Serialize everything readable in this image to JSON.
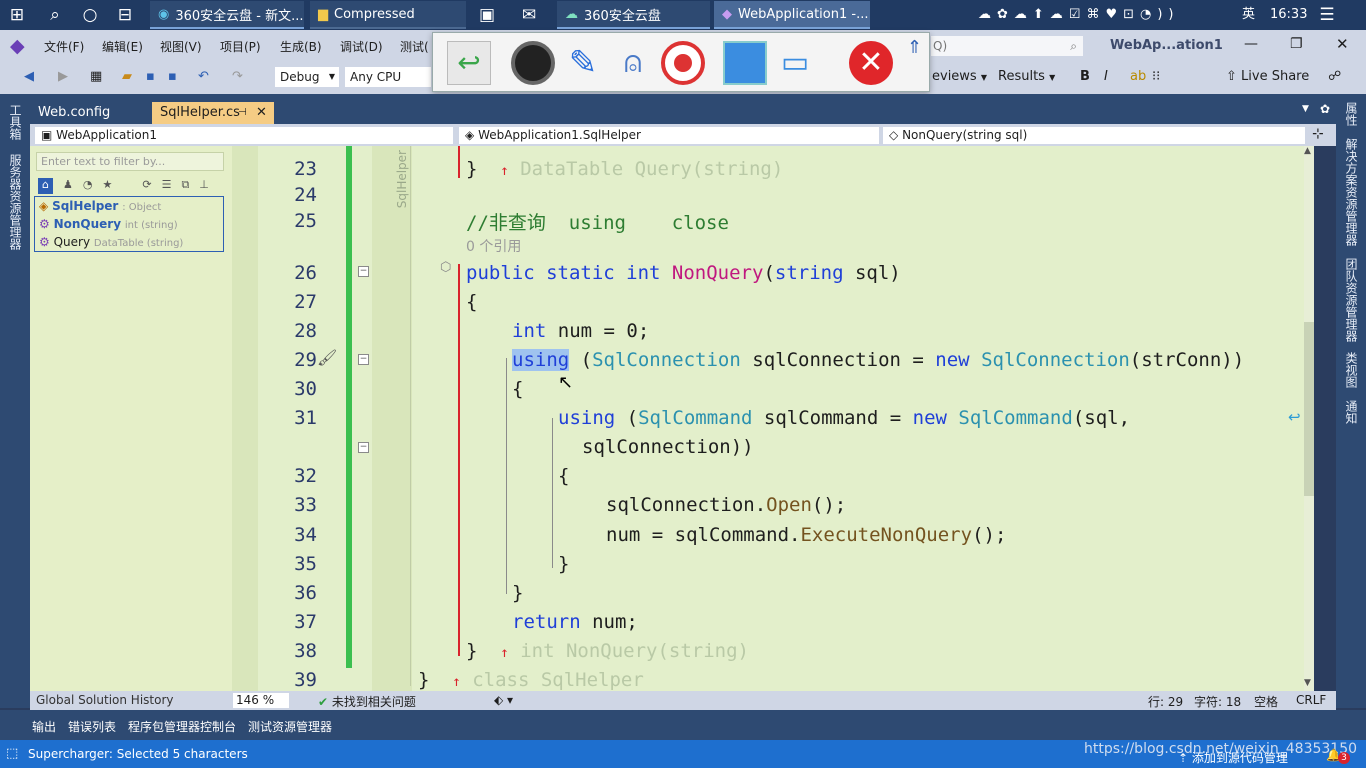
{
  "taskbar": {
    "tasks": [
      {
        "label": "360安全云盘 - 新文..."
      },
      {
        "label": "Compressed"
      },
      {
        "label": "360安全云盘"
      },
      {
        "label": "WebApplication1 -..."
      }
    ],
    "ime": "英",
    "time": "16:33"
  },
  "menubar": {
    "items": [
      "文件(F)",
      "编辑(E)",
      "视图(V)",
      "项目(P)",
      "生成(B)",
      "调试(D)",
      "测试("
    ],
    "search_placeholder": "Q)",
    "solution_title": "WebAp...ation1"
  },
  "toolbar": {
    "config": "Debug",
    "platform": "Any CPU",
    "reviews": "eviews",
    "results": "Results",
    "bold": "B",
    "italic": "I",
    "live_share": "Live Share"
  },
  "tabs": {
    "items": [
      "Web.config",
      "SqlHelper.cs"
    ]
  },
  "navbar": {
    "project": "WebApplication1",
    "class": "WebApplication1.SqlHelper",
    "member": "NonQuery(string sql)"
  },
  "classview": {
    "filter_placeholder": "Enter text to filter by...",
    "items": [
      {
        "name": "SqlHelper",
        "type": ": Object"
      },
      {
        "name": "NonQuery",
        "type": "int (string)"
      },
      {
        "name": "Query",
        "type": "DataTable (string)"
      }
    ],
    "footer": "Global Solution History"
  },
  "left_strip": [
    "工具箱",
    "服务器资源管理器"
  ],
  "right_strip": [
    "属性",
    "解决方案资源管理器",
    "团队资源管理器",
    "类视图",
    "通知"
  ],
  "editor": {
    "margin_label": "SqlHelper",
    "line_numbers": [
      "23",
      "24",
      "25",
      "26",
      "27",
      "28",
      "29",
      "30",
      "31",
      "32",
      "33",
      "34",
      "35",
      "36",
      "37",
      "38",
      "39"
    ],
    "ref_count": "0 个引用",
    "comment": "//非查询  using    close",
    "ghost_query": "DataTable Query(string)",
    "ghost_nonquery": "int NonQuery(string)",
    "ghost_class": "class SqlHelper"
  },
  "status1": {
    "zoom": "146 %",
    "issues": "未找到相关问题",
    "line": "行: 29",
    "col": "字符: 18",
    "space": "空格",
    "eol": "CRLF"
  },
  "bottomtabs": {
    "items": [
      "输出",
      "错误列表",
      "程序包管理器控制台",
      "测试资源管理器"
    ]
  },
  "statusbar": {
    "message": "Supercharger: Selected 5 characters",
    "watermark": "https://blog.csdn.net/weixin_48353150",
    "source_control": "添加到源代码管理",
    "notify_count": "3"
  }
}
